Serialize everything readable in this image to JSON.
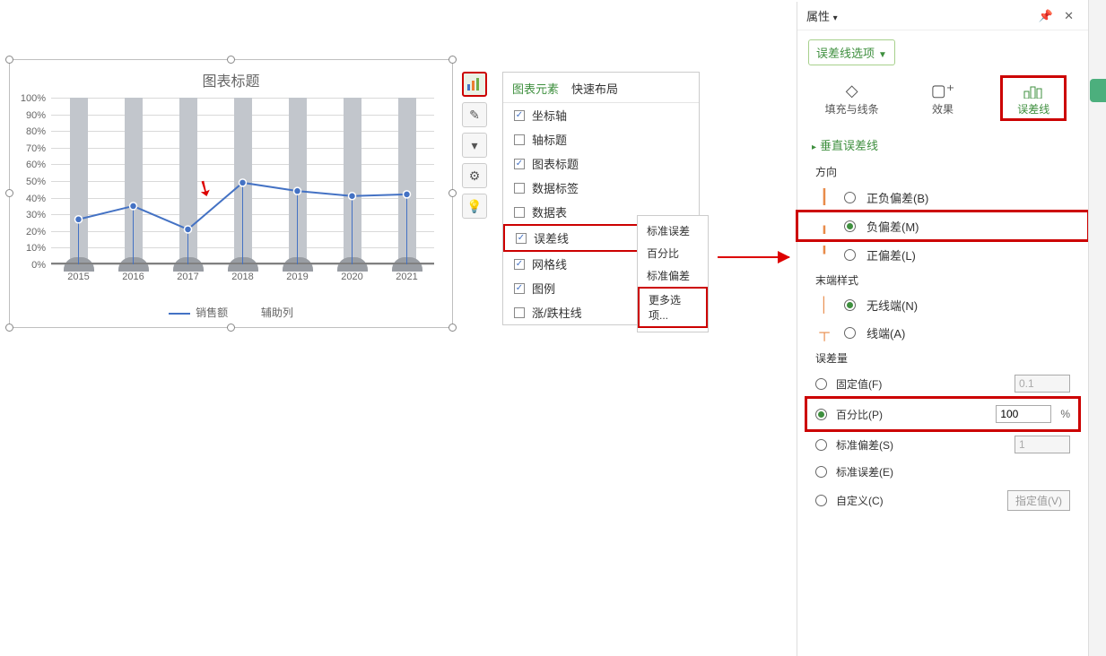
{
  "chart_data": {
    "type": "line",
    "title": "图表标题",
    "categories": [
      "2015",
      "2016",
      "2017",
      "2018",
      "2019",
      "2020",
      "2021"
    ],
    "series": [
      {
        "name": "销售额",
        "values": [
          27,
          35,
          21,
          49,
          44,
          41,
          42
        ]
      },
      {
        "name": "辅助列",
        "values": [
          100,
          100,
          100,
          100,
          100,
          100,
          100
        ]
      }
    ],
    "ylim": [
      0,
      100
    ],
    "yticks": [
      0,
      10,
      20,
      30,
      40,
      50,
      60,
      70,
      80,
      90,
      100
    ],
    "yticklabels": [
      "0%",
      "10%",
      "20%",
      "30%",
      "40%",
      "50%",
      "60%",
      "70%",
      "80%",
      "90%",
      "100%"
    ],
    "xlabel": "",
    "ylabel": "",
    "legend": [
      "销售额",
      "辅助列"
    ]
  },
  "floating_menu": {
    "tab_elements": "图表元素",
    "tab_layout": "快速布局",
    "items": [
      {
        "label": "坐标轴",
        "checked": true
      },
      {
        "label": "轴标题",
        "checked": false
      },
      {
        "label": "图表标题",
        "checked": true
      },
      {
        "label": "数据标签",
        "checked": false
      },
      {
        "label": "数据表",
        "checked": false
      },
      {
        "label": "误差线",
        "checked": true
      },
      {
        "label": "网格线",
        "checked": true
      },
      {
        "label": "图例",
        "checked": true
      },
      {
        "label": "涨/跌柱线",
        "checked": false
      }
    ],
    "submenu": [
      "标准误差",
      "百分比",
      "标准偏差",
      "更多选项..."
    ]
  },
  "panel": {
    "head": "属性",
    "dropdown": "误差线选项",
    "tabs": {
      "fill": "填充与线条",
      "effect": "效果",
      "errbar": "误差线"
    },
    "sec_vertical": "垂直误差线",
    "dir_label": "方向",
    "dir": {
      "both": "正负偏差(B)",
      "minus": "负偏差(M)",
      "plus": "正偏差(L)"
    },
    "end_label": "末端样式",
    "end": {
      "none": "无线端(N)",
      "cap": "线端(A)"
    },
    "amt_label": "误差量",
    "amt": {
      "fixed": "固定值(F)",
      "fixed_val": "0.1",
      "percent": "百分比(P)",
      "percent_val": "100",
      "percent_unit": "%",
      "stdev": "标准偏差(S)",
      "stdev_val": "1",
      "stderr": "标准误差(E)",
      "custom": "自定义(C)",
      "custom_btn": "指定值(V)"
    }
  }
}
